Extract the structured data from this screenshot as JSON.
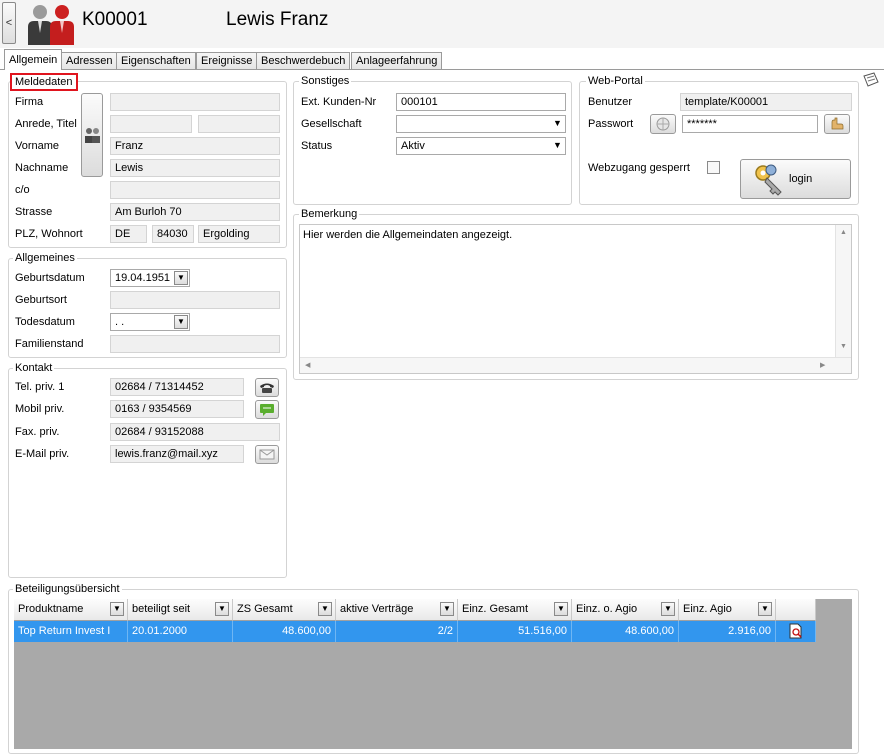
{
  "header": {
    "back_label": "<",
    "customer_id": "K00001",
    "customer_name": "Lewis Franz"
  },
  "tabs": [
    {
      "label": "Allgemein"
    },
    {
      "label": "Adressen"
    },
    {
      "label": "Eigenschaften"
    },
    {
      "label": "Ereignisse"
    },
    {
      "label": "Beschwerdebuch"
    },
    {
      "label": "Anlageerfahrung"
    }
  ],
  "meldedaten": {
    "title": "Meldedaten",
    "firma_label": "Firma",
    "firma": "",
    "anrede_label": "Anrede, Titel",
    "anrede": "",
    "titel": "",
    "vorname_label": "Vorname",
    "vorname": "Franz",
    "nachname_label": "Nachname",
    "nachname": "Lewis",
    "co_label": "c/o",
    "co": "",
    "strasse_label": "Strasse",
    "strasse": "Am Burloh 70",
    "plz_label": "PLZ, Wohnort",
    "land": "DE",
    "plz": "84030",
    "ort": "Ergolding"
  },
  "allgemeines": {
    "title": "Allgemeines",
    "geburtsdatum_label": "Geburtsdatum",
    "geburtsdatum": "19.04.1951",
    "geburtsort_label": "Geburtsort",
    "geburtsort": "",
    "todesdatum_label": "Todesdatum",
    "todesdatum": " .  .",
    "familienstand_label": "Familienstand",
    "familienstand": ""
  },
  "kontakt": {
    "title": "Kontakt",
    "tel_label": "Tel. priv. 1",
    "tel": "02684 / 71314452",
    "mobil_label": "Mobil priv.",
    "mobil": "0163 / 9354569",
    "fax_label": "Fax. priv.",
    "fax": "02684 / 93152088",
    "email_label": "E-Mail priv.",
    "email": "lewis.franz@mail.xyz"
  },
  "sonstiges": {
    "title": "Sonstiges",
    "ext_label": "Ext. Kunden-Nr",
    "ext": "000101",
    "gesellschaft_label": "Gesellschaft",
    "gesellschaft": "",
    "status_label": "Status",
    "status": "Aktiv"
  },
  "webportal": {
    "title": "Web-Portal",
    "benutzer_label": "Benutzer",
    "benutzer": "template/K00001",
    "passwort_label": "Passwort",
    "passwort": "*******",
    "gesperrt_label": "Webzugang gesperrt",
    "login_label": "login"
  },
  "bemerkung": {
    "title": "Bemerkung",
    "text": "Hier werden die Allgemeindaten angezeigt."
  },
  "beteiligung": {
    "title": "Beteiligungsübersicht",
    "columns": [
      "Produktname",
      "beteiligt seit",
      "ZS Gesamt",
      "aktive Verträge",
      "Einz. Gesamt",
      "Einz. o. Agio",
      "Einz. Agio"
    ],
    "rows": [
      {
        "produkt": "Top Return Invest I",
        "seit": "20.01.2000",
        "zs": "48.600,00",
        "vertraege": "2/2",
        "einz_gesamt": "51.516,00",
        "einz_o_agio": "48.600,00",
        "einz_agio": "2.916,00"
      }
    ]
  },
  "colors": {
    "selection": "#3296ee",
    "accent_red": "#e0141e",
    "grid_bg": "#a9a9a9"
  }
}
